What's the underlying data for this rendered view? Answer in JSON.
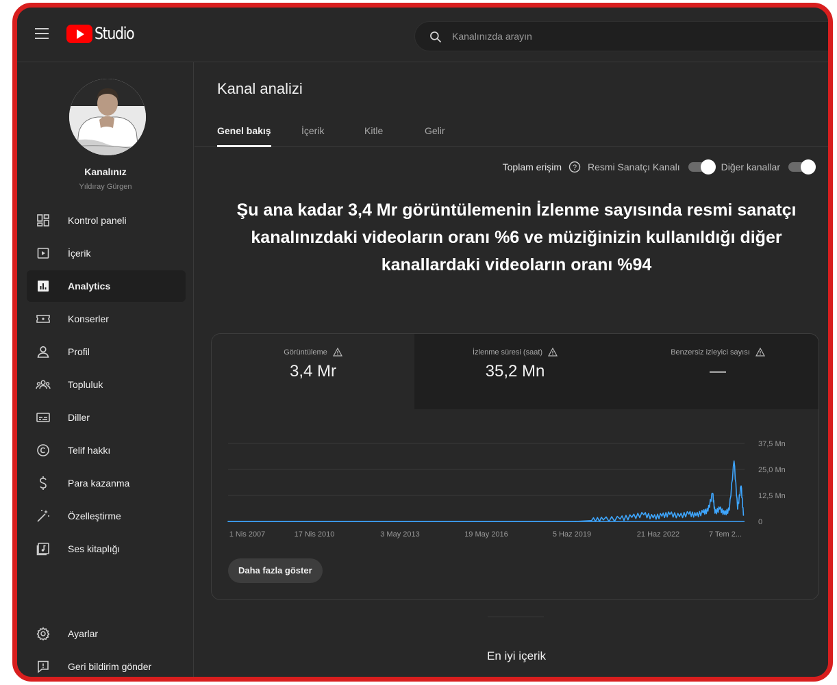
{
  "app": {
    "logo_text": "Studio",
    "brand_color": "#ff0000"
  },
  "search": {
    "placeholder": "Kanalınızda arayın"
  },
  "channel": {
    "name": "Kanalınız",
    "owner": "Yıldıray Gürgen"
  },
  "sidebar": {
    "items": [
      {
        "label": "Kontrol paneli",
        "icon": "dashboard-icon",
        "active": false
      },
      {
        "label": "İçerik",
        "icon": "content-icon",
        "active": false
      },
      {
        "label": "Analytics",
        "icon": "analytics-icon",
        "active": true
      },
      {
        "label": "Konserler",
        "icon": "ticket-icon",
        "active": false
      },
      {
        "label": "Profil",
        "icon": "person-icon",
        "active": false
      },
      {
        "label": "Topluluk",
        "icon": "community-icon",
        "active": false
      },
      {
        "label": "Diller",
        "icon": "subtitles-icon",
        "active": false
      },
      {
        "label": "Telif hakkı",
        "icon": "copyright-icon",
        "active": false
      },
      {
        "label": "Para kazanma",
        "icon": "dollar-icon",
        "active": false
      },
      {
        "label": "Özelleştirme",
        "icon": "magic-wand-icon",
        "active": false
      },
      {
        "label": "Ses kitaplığı",
        "icon": "audio-library-icon",
        "active": false
      }
    ],
    "bottom": [
      {
        "label": "Ayarlar",
        "icon": "gear-icon"
      },
      {
        "label": "Geri bildirim gönder",
        "icon": "feedback-icon"
      }
    ]
  },
  "main": {
    "title": "Kanal analizi",
    "tabs": [
      {
        "label": "Genel bakış",
        "active": true
      },
      {
        "label": "İçerik",
        "active": false
      },
      {
        "label": "Kitle",
        "active": false
      },
      {
        "label": "Gelir",
        "active": false
      }
    ],
    "filters": {
      "total_reach": "Toplam erişim",
      "official_artist_channel": "Resmi Sanatçı Kanalı",
      "official_artist_channel_on": true,
      "other_channels": "Diğer kanallar",
      "other_channels_on": true
    },
    "headline": "Şu ana kadar 3,4 Mr görüntülemenin İzlenme sayısında resmi sanatçı kanalınızdaki videoların oranı %6 ve müziğinizin kullanıldığı diğer kanallardaki videoların oranı %94",
    "metrics": [
      {
        "label": "Görüntüleme",
        "value": "3,4 Mr"
      },
      {
        "label": "İzlenme süresi (saat)",
        "value": "35,2 Mn"
      },
      {
        "label": "Benzersiz izleyici sayısı",
        "value": "—"
      }
    ],
    "show_more": "Daha fazla göster",
    "top_content_title": "En iyi içerik"
  },
  "chart_data": {
    "type": "line",
    "series": [
      {
        "color": "#3ea6ff"
      }
    ],
    "y_ticks": [
      "37,5 Mn",
      "25,0 Mn",
      "12,5 Mn",
      "0"
    ],
    "x_ticks": [
      "1 Nis 2007",
      "17 Nis 2010",
      "3 May 2013",
      "19 May 2016",
      "5 Haz 2019",
      "21 Haz 2022",
      "7 Tem 2..."
    ],
    "ylim": [
      0,
      37.5
    ],
    "grid": true,
    "points": [
      {
        "x": "2007-04-01",
        "y": 0
      },
      {
        "x": "2019-06-05",
        "y": 0
      },
      {
        "x": "2020-01-01",
        "y": 0.4
      },
      {
        "x": "2020-06-01",
        "y": 0.8
      },
      {
        "x": "2021-01-01",
        "y": 1.2
      },
      {
        "x": "2021-06-01",
        "y": 2.0
      },
      {
        "x": "2021-11-01",
        "y": 3.2
      },
      {
        "x": "2022-03-01",
        "y": 1.8
      },
      {
        "x": "2022-06-21",
        "y": 2.6
      },
      {
        "x": "2022-10-01",
        "y": 3.4
      },
      {
        "x": "2023-02-01",
        "y": 2.4
      },
      {
        "x": "2023-06-01",
        "y": 3.6
      },
      {
        "x": "2023-09-01",
        "y": 2.8
      },
      {
        "x": "2023-12-01",
        "y": 4.2
      },
      {
        "x": "2024-02-01",
        "y": 5.0
      },
      {
        "x": "2024-04-01",
        "y": 13.5
      },
      {
        "x": "2024-05-01",
        "y": 4.0
      },
      {
        "x": "2024-07-01",
        "y": 6.0
      },
      {
        "x": "2024-09-01",
        "y": 3.5
      },
      {
        "x": "2024-11-01",
        "y": 5.5
      },
      {
        "x": "2025-01-01",
        "y": 29.0
      },
      {
        "x": "2025-02-15",
        "y": 6.0
      },
      {
        "x": "2025-04-01",
        "y": 17.0
      },
      {
        "x": "2025-05-01",
        "y": 3.0
      }
    ]
  }
}
